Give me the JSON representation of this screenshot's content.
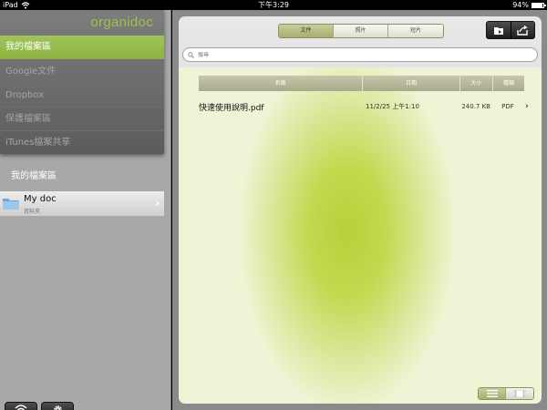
{
  "status_bar": {
    "device": "iPad",
    "time": "下午3:29",
    "battery_text": "94%",
    "battery_level": 0.94
  },
  "app": {
    "logo_text": "organidoc",
    "brand_color": "#9ec24a"
  },
  "sidebar": {
    "sources": [
      {
        "label": "我的檔案區",
        "active": true
      },
      {
        "label": "Google文件",
        "active": false
      },
      {
        "label": "Dropbox",
        "active": false
      },
      {
        "label": "保護檔案區",
        "active": false
      },
      {
        "label": "iTunes檔案共享",
        "active": false
      }
    ],
    "section_title": "我的檔案區",
    "folders": [
      {
        "name": "My doc",
        "subtitle": "資料夾"
      }
    ],
    "bottom_buttons": [
      {
        "icon": "wifi-icon"
      },
      {
        "icon": "gear-icon"
      }
    ]
  },
  "main": {
    "tabs": [
      {
        "label": "文件",
        "active": true
      },
      {
        "label": "照片",
        "active": false
      },
      {
        "label": "短片",
        "active": false
      }
    ],
    "toolbar_icons": [
      "add-folder-icon",
      "share-icon"
    ],
    "search": {
      "placeholder": "搜尋",
      "value": ""
    },
    "table": {
      "columns": [
        "名稱",
        "日期",
        "大小",
        "種類"
      ],
      "rows": [
        {
          "name": "快速使用說明.pdf",
          "date": "11/2/25 上午1:10",
          "size": "240.7 KB",
          "type": "PDF"
        }
      ]
    },
    "view_modes": [
      {
        "icon": "list-view-icon",
        "active": true
      },
      {
        "icon": "thumbnail-view-icon",
        "active": false
      }
    ]
  }
}
